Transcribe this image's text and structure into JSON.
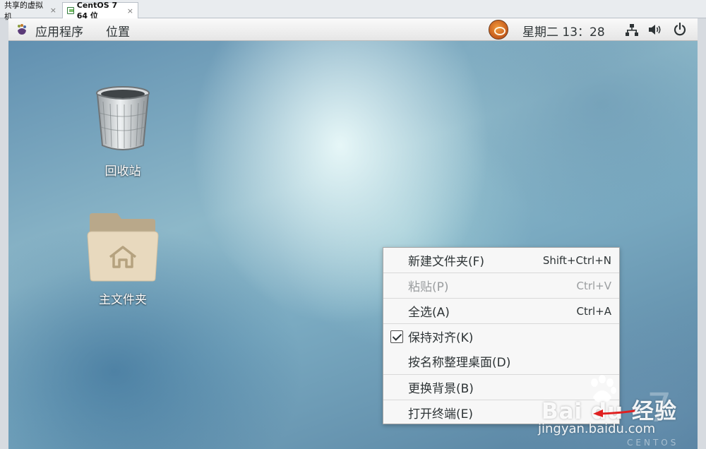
{
  "host": {
    "tabs": [
      {
        "label": "共享的虚拟机",
        "close": "×"
      },
      {
        "label": "CentOS 7 64 位",
        "close": "×"
      }
    ]
  },
  "topbar": {
    "apps": "应用程序",
    "places": "位置",
    "clock": "星期二 13：28",
    "icons": [
      "gnome-foot-icon",
      "user-avatar-icon",
      "network-icon",
      "volume-icon",
      "power-icon"
    ]
  },
  "desktop": {
    "items": [
      {
        "label": "回收站",
        "icon": "trash-icon"
      },
      {
        "label": "主文件夹",
        "icon": "home-folder-icon"
      }
    ]
  },
  "context_menu": {
    "items": [
      {
        "label": "新建文件夹(F)",
        "accel": "Shift+Ctrl+N"
      },
      {
        "label": "粘贴(P)",
        "accel": "Ctrl+V",
        "disabled": true
      },
      {
        "label": "全选(A)",
        "accel": "Ctrl+A"
      },
      {
        "label": "保持对齐(K)",
        "checked": true
      },
      {
        "label": "按名称整理桌面(D)"
      },
      {
        "label": "更换背景(B)"
      },
      {
        "label": "打开终端(E)"
      }
    ]
  },
  "watermarks": {
    "centos_text": "CENTOS",
    "centos_seven": "7",
    "logo": "Bai du 经验",
    "url": "jingyan.baidu.com"
  },
  "colors": {
    "menu_bg": "#f7f7f7",
    "topbar_bg": "#ececec",
    "annotation_arrow": "#e02020"
  }
}
